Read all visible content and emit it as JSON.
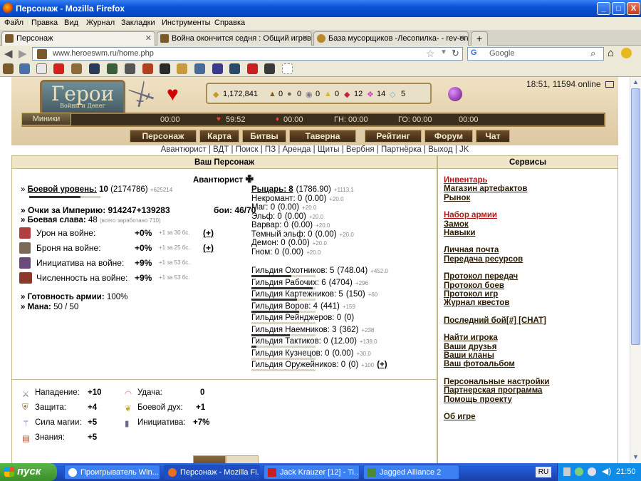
{
  "window": {
    "title": "Персонаж - Mozilla Firefox",
    "controls": [
      "_",
      "□",
      "X"
    ]
  },
  "menu": [
    "Файл",
    "Правка",
    "Вид",
    "Журнал",
    "Закладки",
    "Инструменты",
    "Справка"
  ],
  "tabs": [
    {
      "label": "Персонаж",
      "close": "✕"
    },
    {
      "label": "Война окончится седня : Общий игрово...",
      "close": "✕"
    },
    {
      "label": "База мусорщиков -Лесопилка- - rev-onli...",
      "close": "✕"
    }
  ],
  "new_tab": "+",
  "nav": {
    "url": "www.heroeswm.ru/home.php",
    "search_placeholder": "Google"
  },
  "header": {
    "logo_title": "Герои",
    "logo_sub": "Войны и Денег",
    "time_online": "18:51, 11594 online",
    "resources": {
      "gold": "1,172,841",
      "wood": "0",
      "ore": "0",
      "mercury": "0",
      "sulfur": "0",
      "crystal": "12",
      "gems": "14",
      "diamonds": "5"
    },
    "minis": "Миники",
    "timers": [
      {
        "label": "00:00"
      },
      {
        "label": "59:52"
      },
      {
        "label": "00:00"
      },
      {
        "label": "ГН: 00:00"
      },
      {
        "label": "ГО: 00:00"
      },
      {
        "label": "00:00"
      }
    ],
    "nav": [
      "Персонаж",
      "Карта",
      "Битвы",
      "Таверна",
      "Рейтинг",
      "Форум",
      "Чат"
    ]
  },
  "sublinks": "Авантюрист | ВДТ | Поиск | ПЗ | Аренда | Щиты | Вербня | Партнёрка | Выход | JK",
  "main_panel": {
    "title": "Ваш Персонаж",
    "class_title": "Авантюрист",
    "combat_level_label": "Боевой уровень:",
    "combat_level_value": "10",
    "combat_level_exp": "(2174786)",
    "combat_level_extra": "+625214",
    "empire_points": "» Очки за Империю: 914247+139283",
    "battles": "бои: 46/70",
    "glory": "» Боевая слава:",
    "glory_value": "48",
    "glory_extra": "(всего заработано 710)",
    "war_bonuses": [
      {
        "label": "Урон на войне:",
        "value": "+0%",
        "extra": "+1 за 30 бс.",
        "plus": "(+)"
      },
      {
        "label": "Броня на войне:",
        "value": "+0%",
        "extra": "+1 за 25 бс.",
        "plus": "(+)"
      },
      {
        "label": "Инициатива на войне:",
        "value": "+9%",
        "extra": "+1 за 53 бс.",
        "plus": ""
      },
      {
        "label": "Численность на войне:",
        "value": "+9%",
        "extra": "+1 за 53 бс.",
        "plus": ""
      }
    ],
    "army_ready_label": "» Готовность армии:",
    "army_ready_value": "100%",
    "mana_label": "» Мана:",
    "mana_value": "50 / 50",
    "factions": [
      {
        "name": "Рыцарь: 8",
        "val": "(1786.90)",
        "extra": "+1113.1",
        "bold": true
      },
      {
        "name": "Некромант: 0",
        "val": "(0.00)",
        "extra": "+20.0"
      },
      {
        "name": "Маг: 0",
        "val": "(0.00)",
        "extra": "+20.0"
      },
      {
        "name": "Эльф: 0",
        "val": "(0.00)",
        "extra": "+20.0"
      },
      {
        "name": "Варвар: 0",
        "val": "(0.00)",
        "extra": "+20.0"
      },
      {
        "name": "Темный эльф: 0",
        "val": "(0.00)",
        "extra": "+20.0"
      },
      {
        "name": "Демон: 0",
        "val": "(0.00)",
        "extra": "+20.0"
      },
      {
        "name": "Гном: 0",
        "val": "(0.00)",
        "extra": "+20.0"
      }
    ],
    "guilds": [
      {
        "name": "Гильдия Охотников: 5",
        "val": "(748.04)",
        "extra": "+452.0"
      },
      {
        "name": "Гильдия Рабочих: 6",
        "val": "(4704)",
        "extra": "+296"
      },
      {
        "name": "Гильдия Картежников: 5",
        "val": "(150)",
        "extra": "+60"
      },
      {
        "name": "Гильдия Воров: 4",
        "val": "(441)",
        "extra": "+159"
      },
      {
        "name": "Гильдия Рейнджеров: 0",
        "val": "(0)",
        "extra": ""
      },
      {
        "name": "Гильдия Наемников: 3",
        "val": "(362)",
        "extra": "+238"
      },
      {
        "name": "Гильдия Тактиков: 0",
        "val": "(12.00)",
        "extra": "+138.0"
      },
      {
        "name": "Гильдия Кузнецов: 0",
        "val": "(0.00)",
        "extra": "+30.0"
      },
      {
        "name": "Гильдия Оружейников: 0",
        "val": "(0)",
        "extra": "+100",
        "plus": "(+)"
      }
    ],
    "guild_progress": [
      0.62,
      0.96,
      0.71,
      0.74,
      0,
      0.6,
      0.08,
      0,
      0
    ],
    "stats": [
      {
        "label": "Нападение:",
        "value": "+10"
      },
      {
        "label": "Защита:",
        "value": "+4"
      },
      {
        "label": "Сила магии:",
        "value": "+5"
      },
      {
        "label": "Знания:",
        "value": "+5"
      }
    ],
    "stats2": [
      {
        "label": "Удача:",
        "value": "0"
      },
      {
        "label": "Боевой дух:",
        "value": "+1"
      },
      {
        "label": "Инициатива:",
        "value": "+7%"
      }
    ]
  },
  "services": {
    "title": "Сервисы",
    "groups": [
      [
        "Инвентарь",
        "Магазин артефактов",
        "Рынок"
      ],
      [
        "Набор армии",
        "Замок",
        "Навыки"
      ],
      [
        "Личная почта",
        "Передача ресурсов"
      ],
      [
        "Протокол передач",
        "Протокол боев",
        "Протокол игр",
        "Журнал квестов"
      ],
      [
        "Последний бой[#] [CHAT]"
      ],
      [
        "Найти игрока",
        "Ваши друзья",
        "Ваши кланы",
        "Ваш фотоальбом"
      ],
      [
        "Персональные настройки",
        "Партнерская программа",
        "Помощь проекту"
      ],
      [
        "Об игре"
      ]
    ]
  },
  "taskbar": {
    "start": "пуск",
    "tasks": [
      "Проигрыватель Win...",
      "Персонаж - Mozilla Fi...",
      "Jack Krauzer [12] - Ti...",
      "Jagged Alliance 2"
    ],
    "lang": "RU",
    "clock": "21:50"
  }
}
